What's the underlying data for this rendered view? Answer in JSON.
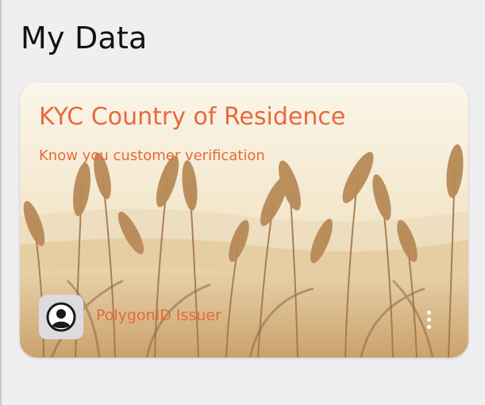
{
  "page": {
    "title": "My Data"
  },
  "card": {
    "title": "KYC Country of Residence",
    "subtitle": "Know you customer verification",
    "issuer": {
      "name": "PolygonID Issuer",
      "avatar_icon": "person-circle-icon"
    },
    "more_icon": "more-vertical-icon",
    "background": "wheat-field-illustration",
    "accent_color": "#e8693a"
  }
}
